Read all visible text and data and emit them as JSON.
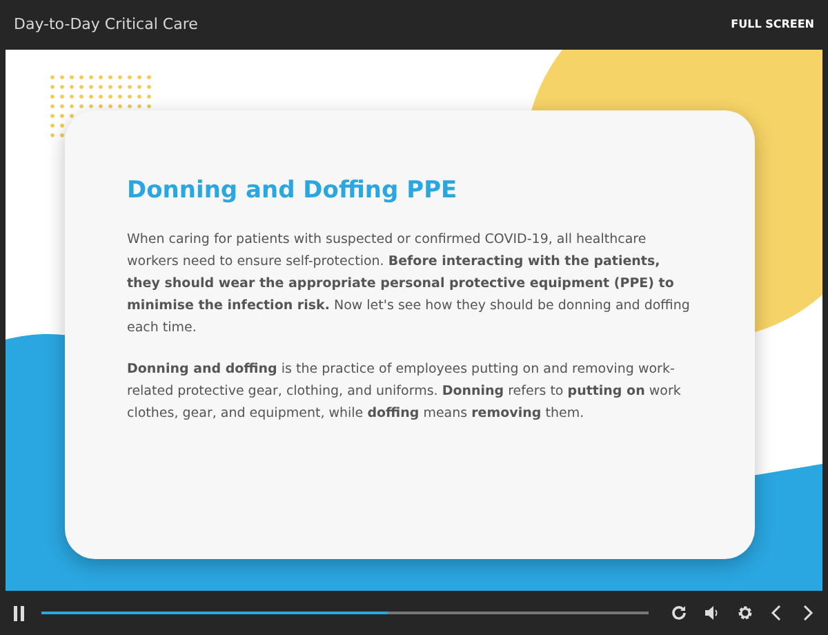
{
  "header": {
    "title": "Day-to-Day Critical Care",
    "fullscreen_label": "FULL SCREEN"
  },
  "slide": {
    "heading": "Donning and Doffing PPE",
    "paragraphs": [
      "When caring for patients with suspected or confirmed COVID-19, all healthcare workers need to ensure self-protection. **Before interacting with the patients, they should wear the appropriate personal protective equipment (PPE) to minimise the infection risk.** Now let's see how they should be donning and doffing each time.",
      "**Donning and doffing** is the practice of employees putting on and removing work-related protective gear, clothing, and uniforms. **Donning** refers to **putting on** work clothes, gear, and equipment, while **doffing** means **removing** them."
    ]
  },
  "player": {
    "playing": true,
    "progress": {
      "level": 0.57
    }
  }
}
